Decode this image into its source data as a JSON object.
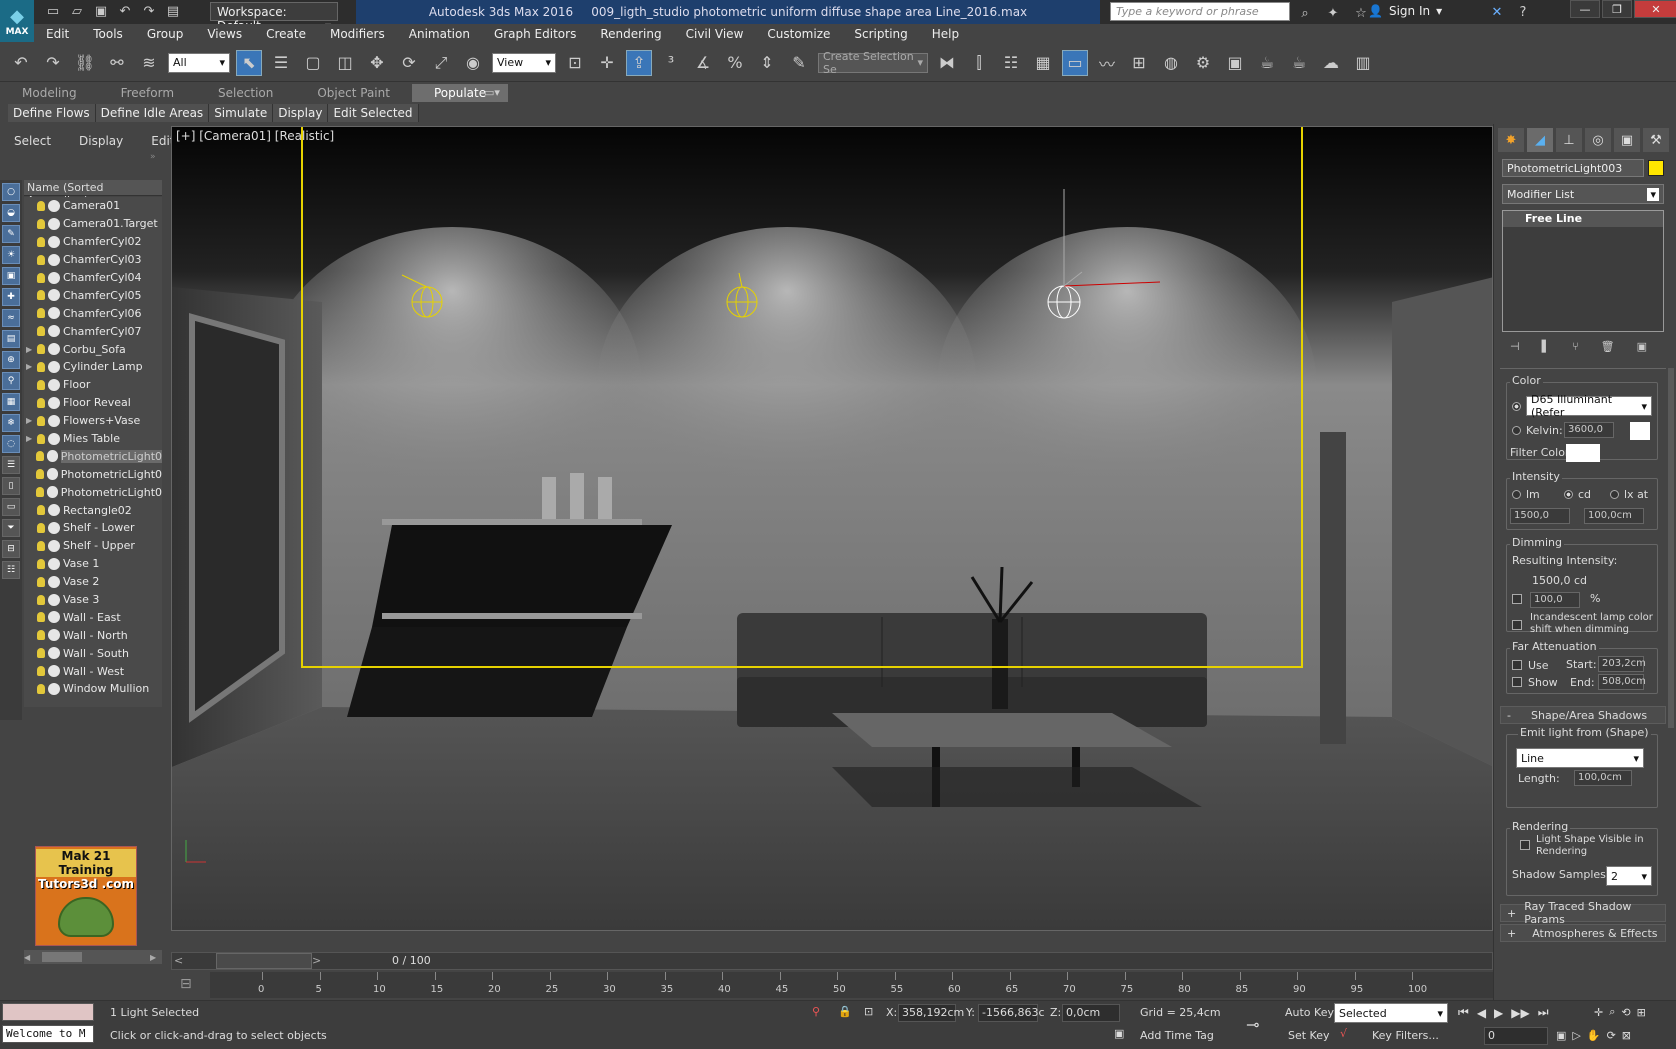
{
  "app": {
    "logo_text": "MAX",
    "workspace": "Workspace: Default",
    "product": "Autodesk 3ds Max 2016",
    "file": "009_ligth_studio photometric uniform diffuse shape area Line_2016.max",
    "search_placeholder": "Type a keyword or phrase",
    "sign_in": "Sign In"
  },
  "menus": [
    "Edit",
    "Tools",
    "Group",
    "Views",
    "Create",
    "Modifiers",
    "Animation",
    "Graph Editors",
    "Rendering",
    "Civil View",
    "Customize",
    "Scripting",
    "Help"
  ],
  "toolbar": {
    "selection_filter": "All",
    "ref_coord": "View",
    "named_selection": "Create Selection Se"
  },
  "ribbon": {
    "tabs": [
      "Modeling",
      "Freeform",
      "Selection",
      "Object Paint",
      "Populate"
    ],
    "buttons": [
      "Define Flows",
      "Define Idle Areas",
      "Simulate",
      "Display",
      "Edit Selected"
    ]
  },
  "scene_explorer": {
    "menus": [
      "Select",
      "Display",
      "Edit"
    ],
    "header": "Name (Sorted Ascending)",
    "items": [
      {
        "name": "Camera01",
        "expand": ""
      },
      {
        "name": "Camera01.Target",
        "expand": ""
      },
      {
        "name": "ChamferCyl02",
        "expand": ""
      },
      {
        "name": "ChamferCyl03",
        "expand": ""
      },
      {
        "name": "ChamferCyl04",
        "expand": ""
      },
      {
        "name": "ChamferCyl05",
        "expand": ""
      },
      {
        "name": "ChamferCyl06",
        "expand": ""
      },
      {
        "name": "ChamferCyl07",
        "expand": ""
      },
      {
        "name": "Corbu_Sofa",
        "expand": "▶"
      },
      {
        "name": "Cylinder Lamp",
        "expand": "▶"
      },
      {
        "name": "Floor",
        "expand": ""
      },
      {
        "name": "Floor Reveal",
        "expand": ""
      },
      {
        "name": "Flowers+Vase",
        "expand": "▶"
      },
      {
        "name": "Mies Table",
        "expand": "▶"
      },
      {
        "name": "PhotometricLight0",
        "expand": ""
      },
      {
        "name": "PhotometricLight0",
        "expand": ""
      },
      {
        "name": "PhotometricLight0",
        "expand": ""
      },
      {
        "name": "Rectangle02",
        "expand": ""
      },
      {
        "name": "Shelf - Lower",
        "expand": ""
      },
      {
        "name": "Shelf - Upper",
        "expand": ""
      },
      {
        "name": "Vase 1",
        "expand": ""
      },
      {
        "name": "Vase 2",
        "expand": ""
      },
      {
        "name": "Vase 3",
        "expand": ""
      },
      {
        "name": "Wall - East",
        "expand": ""
      },
      {
        "name": "Wall - North",
        "expand": ""
      },
      {
        "name": "Wall - South",
        "expand": ""
      },
      {
        "name": "Wall - West",
        "expand": ""
      },
      {
        "name": "Window Mullion",
        "expand": ""
      }
    ],
    "selected_index": 14
  },
  "promo": {
    "line1": "Mak 21 Training",
    "line2": "Tutors3d .com"
  },
  "viewport": {
    "label": "[+] [Camera01] [Realistic]"
  },
  "time": {
    "frame": "0 / 100",
    "ticks": [
      0,
      5,
      10,
      15,
      20,
      25,
      30,
      35,
      40,
      45,
      50,
      55,
      60,
      65,
      70,
      75,
      80,
      85,
      90,
      95,
      100
    ]
  },
  "status": {
    "console": "Welcome to M",
    "selected": "1 Light Selected",
    "prompt": "Click or click-and-drag to select objects",
    "x_label": "X:",
    "x": "358,192cm",
    "y_label": "Y:",
    "y": "-1566,863c",
    "z_label": "Z:",
    "z": "0,0cm",
    "grid": "Grid = 25,4cm",
    "auto_key": "Auto Key",
    "set_key": "Set Key",
    "key_mode": "Selected",
    "key_filters": "Key Filters...",
    "add_time_tag": "Add Time Tag",
    "frame_field": "0"
  },
  "command_panel": {
    "object_name": "PhotometricLight003",
    "object_color": "#ffe600",
    "modifier_list": "Modifier List",
    "stack_item": "Free Line",
    "color_group": "Color",
    "color_preset": "D65 Illuminant (Refer",
    "kelvin_label": "Kelvin:",
    "kelvin": "3600,0",
    "filter_color_label": "Filter Color:",
    "intensity_group": "Intensity",
    "unit_lm": "lm",
    "unit_cd": "cd",
    "unit_lx": "lx at",
    "intensity_value": "1500,0",
    "intensity_dist": "100,0cm",
    "dimming_group": "Dimming",
    "resulting_label": "Resulting Intensity:",
    "resulting_value": "1500,0 cd",
    "dim_percent": "100,0",
    "percent_sign": "%",
    "incandescent": "Incandescent lamp color shift when dimming",
    "far_att_group": "Far Attenuation",
    "use": "Use",
    "show": "Show",
    "start_label": "Start:",
    "start": "203,2cm",
    "end_label": "End:",
    "end": "508,0cm",
    "shape_rollout": "Shape/Area Shadows",
    "emit_group": "Emit light from (Shape)",
    "shape_type": "Line",
    "length_label": "Length:",
    "length": "100,0cm",
    "rendering_group": "Rendering",
    "light_shape_visible": "Light Shape Visible in Rendering",
    "shadow_samples_label": "Shadow Samples:",
    "shadow_samples": "2",
    "rollout_ray": "Ray Traced Shadow Params",
    "rollout_atmos": "Atmospheres & Effects",
    "minus": "-",
    "plus": "+"
  },
  "colors": {
    "selection_frame": "#e6d200",
    "title_accent": "#1e3f6d"
  }
}
